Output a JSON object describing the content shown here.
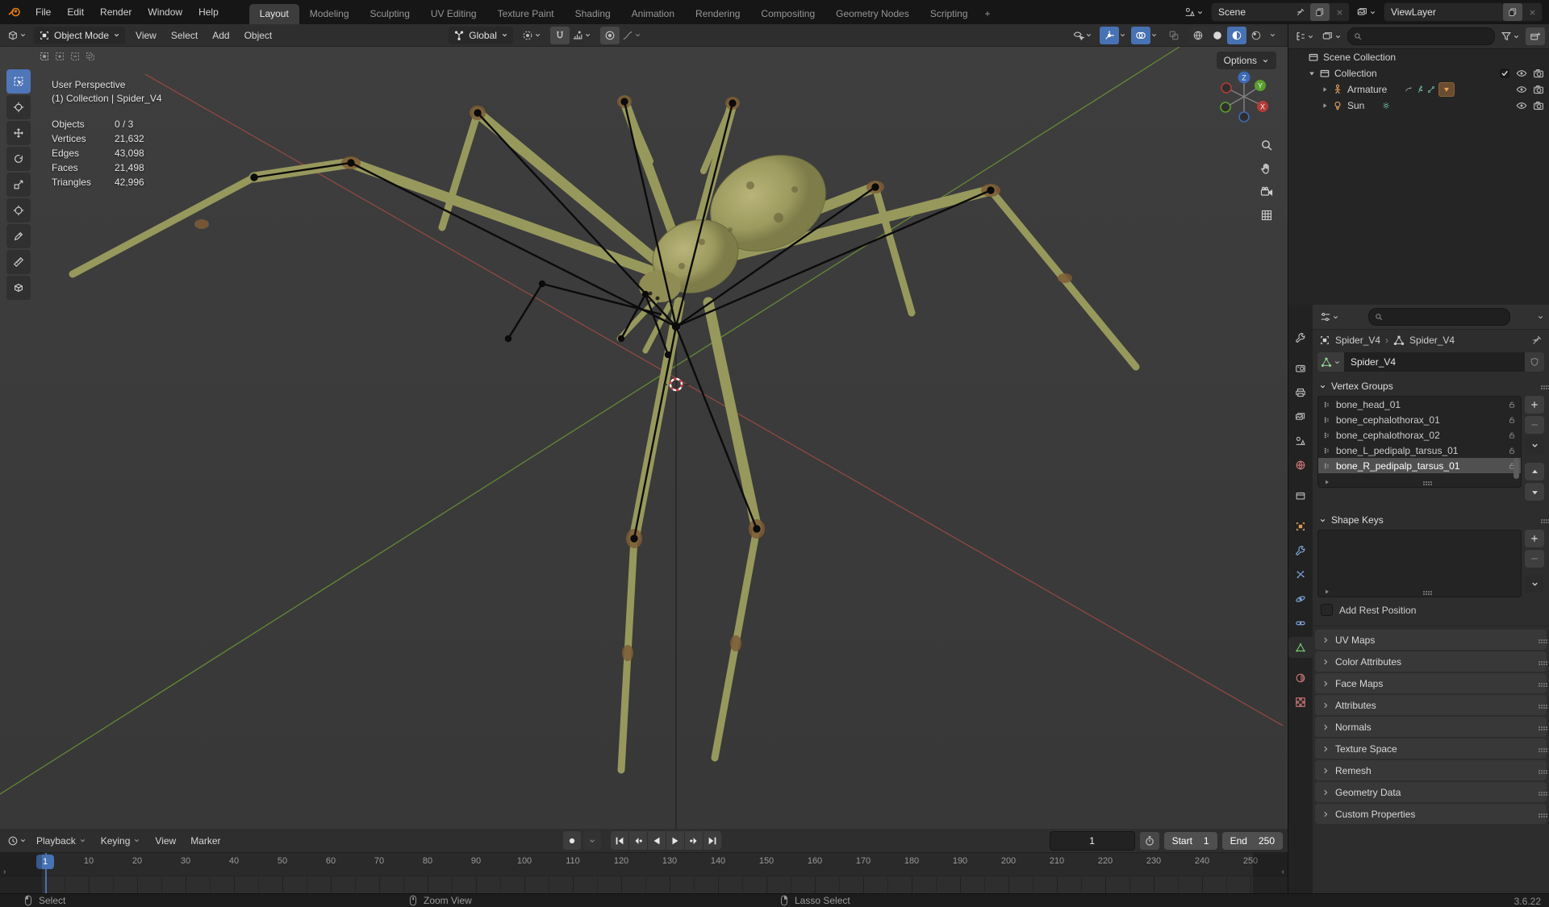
{
  "topbar": {
    "menus": [
      "File",
      "Edit",
      "Render",
      "Window",
      "Help"
    ],
    "tabs": [
      "Layout",
      "Modeling",
      "Sculpting",
      "UV Editing",
      "Texture Paint",
      "Shading",
      "Animation",
      "Rendering",
      "Compositing",
      "Geometry Nodes",
      "Scripting"
    ],
    "active_tab": "Layout",
    "add_tab_label": "+",
    "scene": {
      "label": "Scene"
    },
    "view_layer": {
      "label": "ViewLayer"
    }
  },
  "viewport": {
    "header": {
      "mode": "Object Mode",
      "menus": [
        "View",
        "Select",
        "Add",
        "Object"
      ],
      "orientation": "Global",
      "options_label": "Options"
    },
    "toolbar": [
      {
        "icon": "select-box",
        "active": true
      },
      {
        "icon": "cursor-tool",
        "active": false
      },
      {
        "icon": "move-tool",
        "active": false
      },
      {
        "icon": "rotate-tool",
        "active": false
      },
      {
        "icon": "scale-tool",
        "active": false
      },
      {
        "icon": "transform-tool",
        "active": false
      },
      {
        "icon": "annotate-tool",
        "active": false
      },
      {
        "icon": "measure-tool",
        "active": false
      },
      {
        "icon": "add-cube-tool",
        "active": false
      }
    ],
    "overlay": {
      "perspective": "User Perspective",
      "context": "(1) Collection | Spider_V4",
      "stats": [
        {
          "label": "Objects",
          "value": "0 / 3"
        },
        {
          "label": "Vertices",
          "value": "21,632"
        },
        {
          "label": "Edges",
          "value": "43,098"
        },
        {
          "label": "Faces",
          "value": "21,498"
        },
        {
          "label": "Triangles",
          "value": "42,996"
        }
      ]
    },
    "gizmo": {
      "x": "X",
      "y": "Y",
      "z": "Z"
    }
  },
  "outliner": {
    "rows": [
      {
        "label": "Scene Collection",
        "icon": "collection",
        "indent": 0,
        "disclosure": "none",
        "badges": [],
        "right": []
      },
      {
        "label": "Collection",
        "icon": "collection",
        "indent": 1,
        "disclosure": "down",
        "badges": [],
        "right": [
          "checkbox",
          "eye",
          "camera"
        ]
      },
      {
        "label": "Armature",
        "icon": "armature",
        "indent": 2,
        "disclosure": "right",
        "badges": [
          "action",
          "pose",
          "bone",
          "tri-badge"
        ],
        "right": [
          "eye",
          "camera"
        ]
      },
      {
        "label": "Sun",
        "icon": "light",
        "indent": 2,
        "disclosure": "right",
        "badges": [
          "sun"
        ],
        "right": [
          "eye",
          "camera"
        ]
      }
    ]
  },
  "properties": {
    "tabs": [
      {
        "icon": "tool",
        "color": "#b8b8b8",
        "group": 0
      },
      {
        "icon": "render",
        "color": "#b8b8b8",
        "group": 1
      },
      {
        "icon": "output",
        "color": "#b8b8b8",
        "group": 1
      },
      {
        "icon": "viewlayer",
        "color": "#b8b8b8",
        "group": 1
      },
      {
        "icon": "scene",
        "color": "#b8b8b8",
        "group": 1
      },
      {
        "icon": "world",
        "color": "#c77474",
        "group": 1
      },
      {
        "icon": "collection",
        "color": "#b8b8b8",
        "group": 2
      },
      {
        "icon": "object",
        "color": "#dd9b5a",
        "group": 3
      },
      {
        "icon": "modifiers",
        "color": "#7fa4d8",
        "group": 3
      },
      {
        "icon": "particles",
        "color": "#7fa4d8",
        "group": 3
      },
      {
        "icon": "physics",
        "color": "#7fa4d8",
        "group": 3
      },
      {
        "icon": "constraints",
        "color": "#7fa4d8",
        "group": 3
      },
      {
        "icon": "meshdata",
        "color": "#6ec76e",
        "group": 3,
        "active": true
      },
      {
        "icon": "material",
        "color": "#c77474",
        "group": 4
      },
      {
        "icon": "texture",
        "color": "#c77474",
        "group": 4
      }
    ],
    "breadcrumb": {
      "object": "Spider_V4",
      "separator": "›",
      "data": "Spider_V4"
    },
    "datablock": {
      "name": "Spider_V4"
    },
    "vertex_groups": {
      "title": "Vertex Groups",
      "items": [
        "bone_head_01",
        "bone_cephalothorax_01",
        "bone_cephalothorax_02",
        "bone_L_pedipalp_tarsus_01",
        "bone_R_pedipalp_tarsus_01"
      ],
      "selected_index": 4
    },
    "shape_keys": {
      "title": "Shape Keys"
    },
    "add_rest_position_label": "Add Rest Position",
    "panels": [
      "UV Maps",
      "Color Attributes",
      "Face Maps",
      "Attributes",
      "Normals",
      "Texture Space",
      "Remesh",
      "Geometry Data",
      "Custom Properties"
    ]
  },
  "timeline": {
    "menus": [
      {
        "label": "Playback",
        "dropdown": true
      },
      {
        "label": "Keying",
        "dropdown": true
      },
      {
        "label": "View",
        "dropdown": false
      },
      {
        "label": "Marker",
        "dropdown": false
      }
    ],
    "transport": [
      "jump-start",
      "prev-keyframe",
      "play-reverse",
      "play",
      "next-keyframe",
      "jump-end"
    ],
    "current_frame": "1",
    "start_label": "Start",
    "start_value": "1",
    "end_label": "End",
    "end_value": "250",
    "ticks": [
      10,
      20,
      30,
      40,
      50,
      60,
      70,
      80,
      90,
      100,
      110,
      120,
      130,
      140,
      150,
      160,
      170,
      180,
      190,
      200,
      210,
      220,
      230,
      240,
      250
    ]
  },
  "statusbar": {
    "items": [
      {
        "icon": "mouse-left",
        "label": "Select"
      },
      {
        "icon": "mouse-middle",
        "label": "Zoom View"
      },
      {
        "icon": "mouse-right",
        "label": "Lasso Select"
      }
    ],
    "version": "3.6.22"
  },
  "colors": {
    "accent": "#4772b3",
    "axis_x": "#a84a42",
    "axis_y": "#6f9d33",
    "icon_orange": "#dd9b5a",
    "icon_green": "#6ec76e",
    "icon_blue": "#7fa4d8",
    "icon_red": "#c77474"
  }
}
